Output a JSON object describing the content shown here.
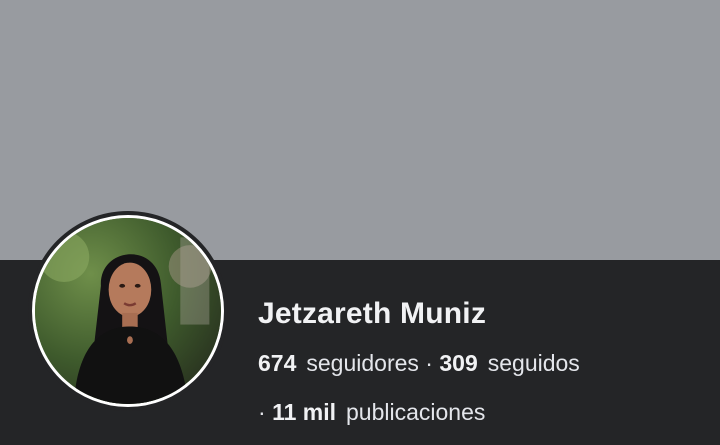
{
  "profile": {
    "name": "Jetzareth Muniz",
    "followers_count": "674",
    "followers_label": "seguidores",
    "separator": "·",
    "following_count": "309",
    "following_label": "seguidos",
    "posts_count": "11 mil",
    "posts_label": "publicaciones"
  },
  "colors": {
    "cover": "#989ba0",
    "panel": "#242527",
    "text": "#e4e6eb"
  }
}
